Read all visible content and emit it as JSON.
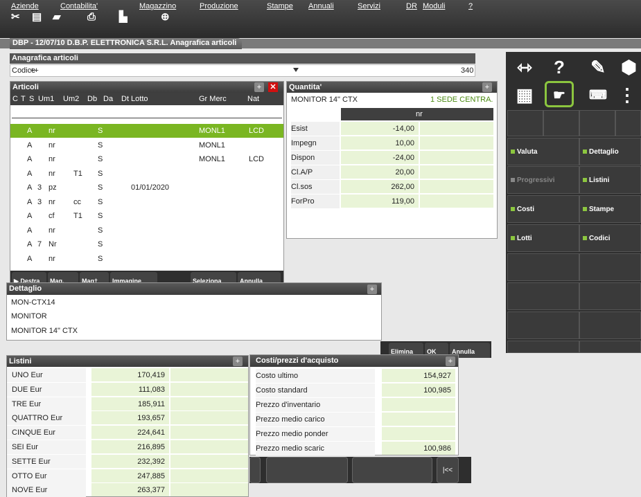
{
  "menu": [
    "Aziende",
    "Contabilita'",
    "Magazzino",
    "Produzione",
    "Stampe",
    "Annuali",
    "Servizi",
    "DR",
    "Moduli",
    "?"
  ],
  "doc_tab": "DBP - 12/07/10 D.B.P. ELETTRONICA S.R.L. Anagrafica articoli",
  "anagrafica": {
    "title": "Anagrafica articoli",
    "codice_label": "Codice",
    "codice_value": "++",
    "count": "340"
  },
  "right_panel": {
    "buttons": [
      {
        "label": "Valuta",
        "enabled": true
      },
      {
        "label": "Dettaglio",
        "enabled": true
      },
      {
        "label": "Progressivi",
        "enabled": false
      },
      {
        "label": "Listini",
        "enabled": true
      },
      {
        "label": "Costi",
        "enabled": true
      },
      {
        "label": "Stampe",
        "enabled": true
      },
      {
        "label": "Lotti",
        "enabled": true
      },
      {
        "label": "Codici",
        "enabled": true
      }
    ]
  },
  "articoli": {
    "title": "Articoli",
    "headers": {
      "c": "C",
      "t": "T",
      "s": "S",
      "um1": "Um1",
      "um2": "Um2",
      "db": "Db",
      "da": "Da",
      "dtlotto": "Dt Lotto",
      "grmerc": "Gr Merc",
      "nat": "Nat"
    },
    "rows": [
      {
        "t": "A",
        "s": "",
        "um1": "nr",
        "um2": "",
        "db": "S",
        "dtlotto": "",
        "grmerc": "MONL1",
        "nat": "LCD"
      },
      {
        "t": "A",
        "s": "",
        "um1": "nr",
        "um2": "",
        "db": "S",
        "dtlotto": "",
        "grmerc": "MONL1",
        "nat": ""
      },
      {
        "t": "A",
        "s": "",
        "um1": "nr",
        "um2": "",
        "db": "S",
        "dtlotto": "",
        "grmerc": "MONL1",
        "nat": "LCD"
      },
      {
        "t": "A",
        "s": "",
        "um1": "nr",
        "um2": "T1",
        "db": "S",
        "dtlotto": "",
        "grmerc": "",
        "nat": ""
      },
      {
        "t": "A",
        "s": "3",
        "um1": "pz",
        "um2": "",
        "db": "S",
        "dtlotto": "01/01/2020",
        "grmerc": "",
        "nat": ""
      },
      {
        "t": "A",
        "s": "3",
        "um1": "nr",
        "um2": "cc",
        "db": "S",
        "dtlotto": "",
        "grmerc": "",
        "nat": ""
      },
      {
        "t": "A",
        "s": "",
        "um1": "cf",
        "um2": "T1",
        "db": "S",
        "dtlotto": "",
        "grmerc": "",
        "nat": ""
      },
      {
        "t": "A",
        "s": "",
        "um1": "nr",
        "um2": "",
        "db": "S",
        "dtlotto": "",
        "grmerc": "",
        "nat": ""
      },
      {
        "t": "A",
        "s": "7",
        "um1": "Nr",
        "um2": "",
        "db": "S",
        "dtlotto": "",
        "grmerc": "",
        "nat": ""
      },
      {
        "t": "A",
        "s": "",
        "um1": "nr",
        "um2": "",
        "db": "S",
        "dtlotto": "",
        "grmerc": "",
        "nat": ""
      }
    ],
    "buttons": [
      "Destra",
      "Mag.",
      "Mag†",
      "Immagine",
      "Seleziona",
      "Annulla"
    ]
  },
  "quantita": {
    "title": "Quantita'",
    "product": "MONITOR 14\" CTX",
    "sede": "1 SEDE CENTRA.",
    "unit": "nr",
    "rows": [
      {
        "label": "Esist",
        "value": "-14,00"
      },
      {
        "label": "Impegn",
        "value": "10,00"
      },
      {
        "label": "Dispon",
        "value": "-24,00"
      },
      {
        "label": "Cl.A/P",
        "value": "20,00"
      },
      {
        "label": "Cl.sos",
        "value": "262,00"
      },
      {
        "label": "ForPro",
        "value": "119,00"
      }
    ]
  },
  "dettaglio": {
    "title": "Dettaglio",
    "lines": [
      "MON-CTX14",
      "MONITOR",
      "MONITOR 14\" CTX"
    ]
  },
  "detbtns": [
    "Elimina",
    "OK",
    "Annulla"
  ],
  "listini": {
    "title": "Listini",
    "rows": [
      {
        "label": "UNO   Eur",
        "value": "170,419"
      },
      {
        "label": "DUE   Eur",
        "value": "111,083"
      },
      {
        "label": "TRE   Eur",
        "value": "185,911"
      },
      {
        "label": "QUATTRO Eur",
        "value": "193,657"
      },
      {
        "label": "CINQUE Eur",
        "value": "224,641"
      },
      {
        "label": "SEI   Eur",
        "value": "216,895"
      },
      {
        "label": "SETTE  Eur",
        "value": "232,392"
      },
      {
        "label": "OTTO   Eur",
        "value": "247,885"
      },
      {
        "label": "NOVE   Eur",
        "value": "263,377"
      }
    ]
  },
  "costi": {
    "title": "Costi/prezzi d'acquisto",
    "rows": [
      {
        "label": "Costo ultimo",
        "value": "154,927"
      },
      {
        "label": "Costo standard",
        "value": "100,985"
      },
      {
        "label": "Prezzo d'inventario",
        "value": ""
      },
      {
        "label": "Prezzo medio carico",
        "value": ""
      },
      {
        "label": "Prezzo medio ponder",
        "value": ""
      },
      {
        "label": "Prezzo medio scaric",
        "value": "100,986"
      }
    ]
  },
  "nav": {
    "first": "|<<"
  }
}
